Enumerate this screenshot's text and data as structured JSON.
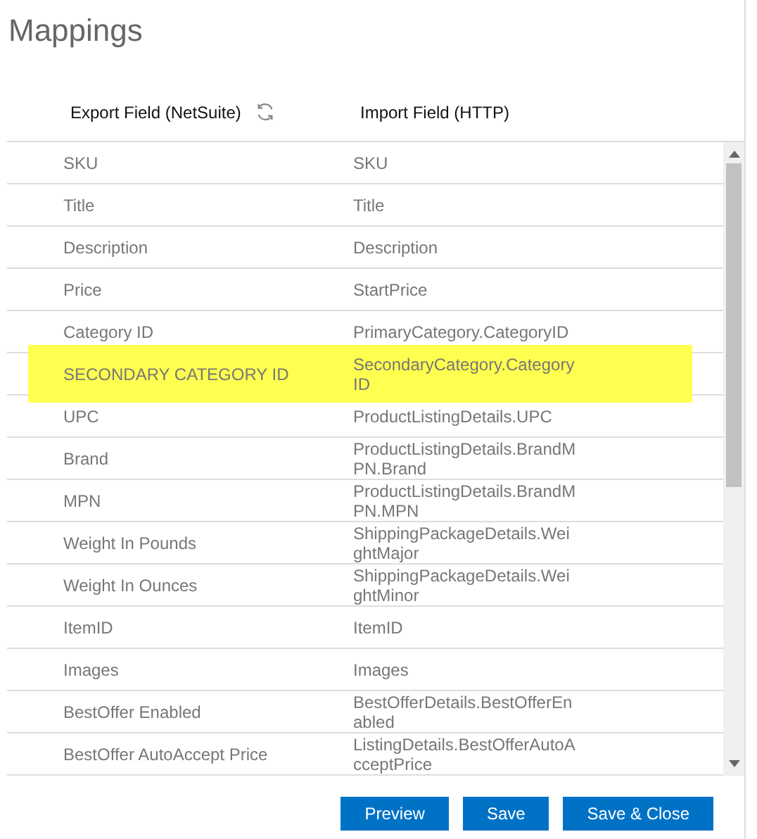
{
  "title": "Mappings",
  "columns": [
    {
      "label": "Export Field (NetSuite)",
      "refresh": true
    },
    {
      "label": "Import Field (HTTP)",
      "refresh": false
    }
  ],
  "rows": [
    {
      "export": "SKU",
      "import": "SKU",
      "highlighted": false
    },
    {
      "export": "Title",
      "import": "Title",
      "highlighted": false
    },
    {
      "export": "Description",
      "import": "Description",
      "highlighted": false
    },
    {
      "export": "Price",
      "import": "StartPrice",
      "highlighted": false
    },
    {
      "export": "Category ID",
      "import": "PrimaryCategory.CategoryID",
      "highlighted": false
    },
    {
      "export": "SECONDARY CATEGORY ID",
      "import": "SecondaryCategory.CategoryID",
      "highlighted": true
    },
    {
      "export": "UPC",
      "import": "ProductListingDetails.UPC",
      "highlighted": false
    },
    {
      "export": "Brand",
      "import": "ProductListingDetails.BrandMPN.Brand",
      "highlighted": false
    },
    {
      "export": "MPN",
      "import": "ProductListingDetails.BrandMPN.MPN",
      "highlighted": false
    },
    {
      "export": "Weight In Pounds",
      "import": "ShippingPackageDetails.WeightMajor",
      "highlighted": false
    },
    {
      "export": "Weight In Ounces",
      "import": "ShippingPackageDetails.WeightMinor",
      "highlighted": false
    },
    {
      "export": "ItemID",
      "import": "ItemID",
      "highlighted": false
    },
    {
      "export": "Images",
      "import": "Images",
      "highlighted": false
    },
    {
      "export": "BestOffer Enabled",
      "import": "BestOfferDetails.BestOfferEnabled",
      "highlighted": false
    },
    {
      "export": "BestOffer AutoAccept Price",
      "import": "ListingDetails.BestOfferAutoAcceptPrice",
      "highlighted": false
    }
  ],
  "buttons": [
    "Preview",
    "Save",
    "Save & Close"
  ]
}
